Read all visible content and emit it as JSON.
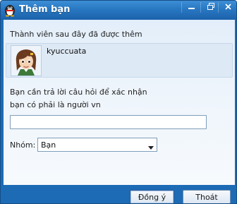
{
  "window": {
    "title": "Thêm bạn"
  },
  "member_section": {
    "label": "Thành viên sau đây đã được thêm",
    "member_name": "kyuccuata"
  },
  "question": {
    "line1": "Bạn cần trả lời câu hỏi để xác nhận",
    "line2": "bạn có phải là người vn",
    "answer_value": ""
  },
  "group": {
    "label": "Nhóm:",
    "selected": "Bạn"
  },
  "buttons": {
    "ok": "Đồng ý",
    "quit": "Thoát"
  },
  "colors": {
    "titlebar": "#2a79c4",
    "frame": "#1d6bb5",
    "content_bg": "#edf4fb"
  },
  "icons": [
    "penguin-icon",
    "minimize-icon",
    "restore-icon",
    "close-icon",
    "chevron-down-icon"
  ]
}
